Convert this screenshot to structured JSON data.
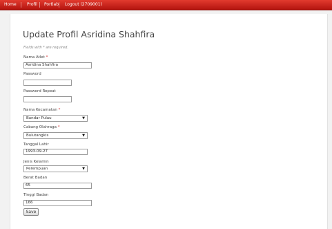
{
  "nav": {
    "items": [
      "Home",
      "Profil",
      "Portlab",
      "Logout (2709001)"
    ]
  },
  "page": {
    "title": "Update Profil Asridina Shahfira",
    "required_note": "Fields with * are required.",
    "required_mark": "*"
  },
  "form": {
    "nama_atlet": {
      "label": "Nama Atlet",
      "value": "Asridina Shahfira"
    },
    "password": {
      "label": "Password",
      "value": ""
    },
    "password_repeat": {
      "label": "Password Repeat",
      "value": ""
    },
    "kecamatan": {
      "label": "Nama Kecamatan",
      "value": "Bandar Pulau"
    },
    "cabang": {
      "label": "Cabang Olahraga",
      "value": "Bulutangkis"
    },
    "tanggal_lahir": {
      "label": "Tanggal Lahir",
      "value": "1993-09-27"
    },
    "jenis_kelamin": {
      "label": "Jenis Kelamin",
      "value": "Perempuan"
    },
    "berat_badan": {
      "label": "Berat Badan",
      "value": "65"
    },
    "tinggi_badan": {
      "label": "Tinggi Badan",
      "value": "166"
    },
    "dropdown_arrow": "▼",
    "save_label": "Save"
  },
  "colors": {
    "navbar": "#c1211b",
    "required": "#d01f1f"
  }
}
